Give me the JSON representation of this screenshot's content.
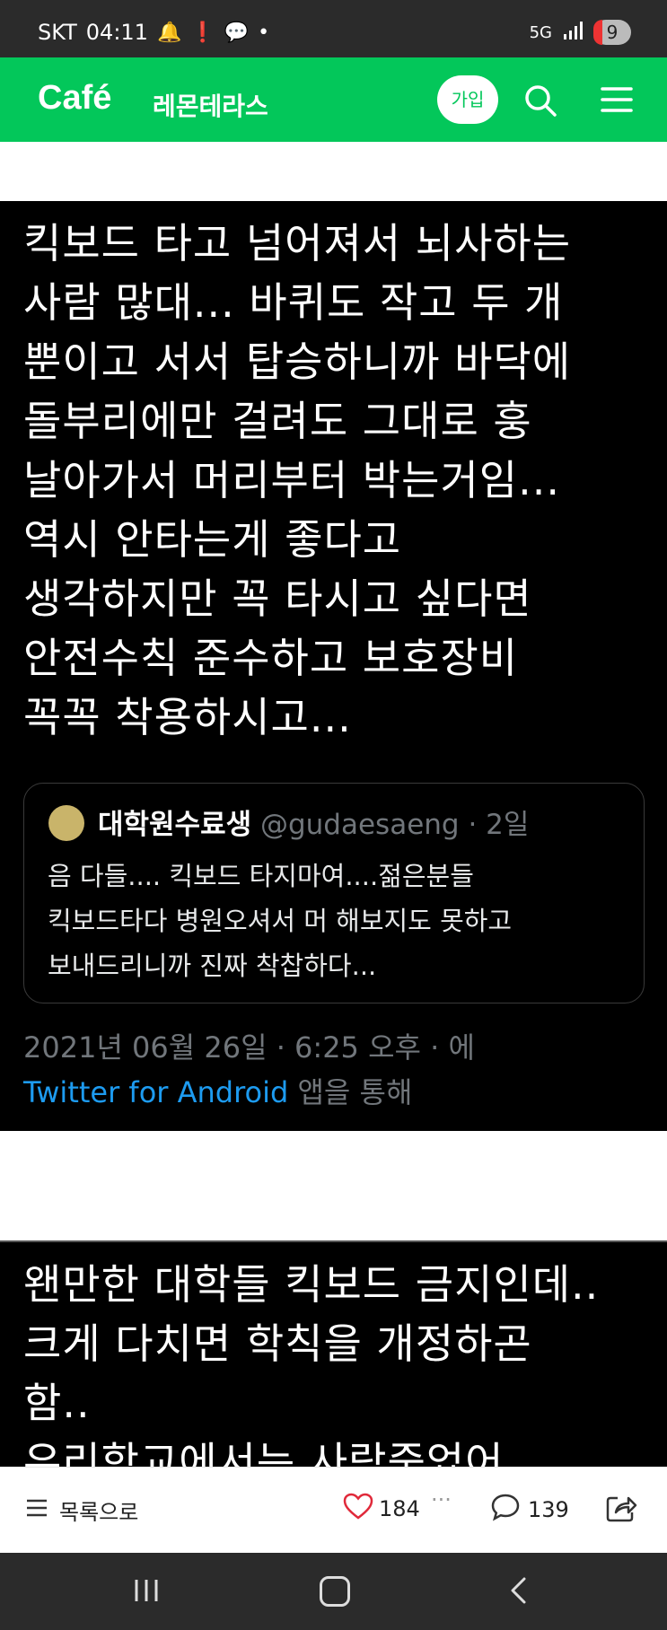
{
  "status_bar": {
    "carrier": "SKT",
    "time": "04:11",
    "network": "5G",
    "battery": "9"
  },
  "cafe_header": {
    "logo": "Café",
    "cafe_name": "레몬테라스",
    "join_label": "가입"
  },
  "tweet1": {
    "text": "킥보드 타고 넘어져서 뇌사하는\n사람 많대... 바퀴도 작고 두 개\n뿐이고 서서 탑승하니까 바닥에\n돌부리에만 걸려도 그대로 훙\n날아가서 머리부터 박는거임...\n역시 안타는게 좋다고\n생각하지만 꼭 타시고 싶다면\n안전수칙 준수하고 보호장비\n꼭꼭 착용하시고...",
    "quote": {
      "name": "대학원수료생",
      "handle": "@gudaesaeng · 2일",
      "text": "음 다들.... 킥보드 타지마여....젊은분들\n킥보드타다 병원오셔서 머 해보지도 못하고\n보내드리니까 진짜 착찹하다..."
    },
    "meta_date": "2021년 06월 26일 · 6:25 오후 · 에",
    "meta_source_link": "Twitter for Android",
    "meta_source_suffix": " 앱을 통해"
  },
  "tweet2": {
    "text": "왠만한 대학들 킥보드 금지인데..\n크게 다치면 학칙을 개정하곤\n함..\n우리학교에서는 사람죽었어"
  },
  "bottom_bar": {
    "list_label": "목록으로",
    "like_count": "184",
    "more_label": "···",
    "comment_count": "139"
  }
}
